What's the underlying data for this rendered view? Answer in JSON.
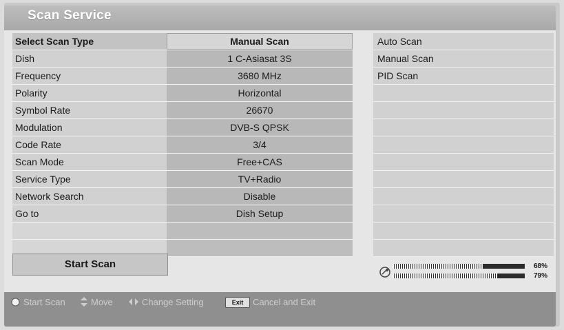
{
  "window": {
    "title": "Scan Service"
  },
  "settings": {
    "rows": [
      {
        "label": "Select Scan Type",
        "value": "Manual Scan"
      },
      {
        "label": "Dish",
        "value": "1 C-Asiasat 3S"
      },
      {
        "label": "Frequency",
        "value": "3680 MHz"
      },
      {
        "label": "Polarity",
        "value": "Horizontal"
      },
      {
        "label": "Symbol Rate",
        "value": "26670"
      },
      {
        "label": "Modulation",
        "value": "DVB-S QPSK"
      },
      {
        "label": "Code Rate",
        "value": "3/4"
      },
      {
        "label": "Scan Mode",
        "value": "Free+CAS"
      },
      {
        "label": "Service Type",
        "value": "TV+Radio"
      },
      {
        "label": "Network Search",
        "value": "Disable"
      },
      {
        "label": "Go to",
        "value": "Dish Setup"
      }
    ]
  },
  "options": [
    "Auto Scan",
    "Manual Scan",
    "PID Scan"
  ],
  "start_button": {
    "label": "Start Scan"
  },
  "signal": {
    "strength_pct": "68%",
    "quality_pct": "79%",
    "strength_level": 0.68,
    "quality_level": 0.79
  },
  "footer": {
    "start_scan": "Start Scan",
    "move": "Move",
    "change_setting": "Change Setting",
    "exit_key": "Exit",
    "cancel_exit": "Cancel and Exit"
  },
  "colors": {
    "footer_bg": "#8f8f8f",
    "panel_bg": "#d1d1d1",
    "value_bg": "#b8b8b8"
  }
}
